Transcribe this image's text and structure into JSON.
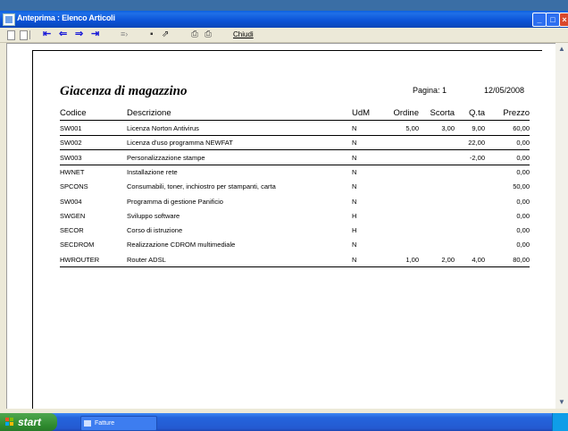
{
  "window": {
    "title": "Anteprima : Elenco Articoli"
  },
  "toolbar": {
    "first_label": "⇤",
    "prev_label": "⇐",
    "next_label": "⇒",
    "last_label": "⇥",
    "close_label": "Chiudi"
  },
  "report": {
    "title": "Giacenza di magazzino",
    "page_label": "Pagina: 1",
    "date": "12/05/2008",
    "columns": {
      "codice": "Codice",
      "descrizione": "Descrizione",
      "udm": "UdM",
      "ordine": "Ordine",
      "scorta": "Scorta",
      "qta": "Q.ta",
      "prezzo": "Prezzo"
    },
    "rows": [
      {
        "codice": "SW001",
        "descrizione": "Licenza Norton Antivirus",
        "udm": "N",
        "ordine": "5,00",
        "scorta": "3,00",
        "qta": "9,00",
        "prezzo": "60,00"
      },
      {
        "codice": "SW002",
        "descrizione": "Licenza d'uso programma NEWFAT",
        "udm": "N",
        "ordine": "",
        "scorta": "",
        "qta": "22,00",
        "prezzo": "0,00"
      },
      {
        "codice": "SW003",
        "descrizione": "Personalizzazione stampe",
        "udm": "N",
        "ordine": "",
        "scorta": "",
        "qta": "-2,00",
        "prezzo": "0,00"
      },
      {
        "codice": "HWNET",
        "descrizione": "Installazione rete",
        "udm": "N",
        "ordine": "",
        "scorta": "",
        "qta": "",
        "prezzo": "0,00"
      },
      {
        "codice": "SPCONS",
        "descrizione": "Consumabili, toner, inchiostro per stampanti, carta",
        "udm": "N",
        "ordine": "",
        "scorta": "",
        "qta": "",
        "prezzo": "50,00"
      },
      {
        "codice": "SW004",
        "descrizione": "Programma di gestione Panificio",
        "udm": "N",
        "ordine": "",
        "scorta": "",
        "qta": "",
        "prezzo": "0,00"
      },
      {
        "codice": "SWGEN",
        "descrizione": "Sviluppo software",
        "udm": "H",
        "ordine": "",
        "scorta": "",
        "qta": "",
        "prezzo": "0,00"
      },
      {
        "codice": "SECOR",
        "descrizione": "Corso di istruzione",
        "udm": "H",
        "ordine": "",
        "scorta": "",
        "qta": "",
        "prezzo": "0,00"
      },
      {
        "codice": "SECDROM",
        "descrizione": "Realizzazione CDROM multimediale",
        "udm": "N",
        "ordine": "",
        "scorta": "",
        "qta": "",
        "prezzo": "0,00"
      },
      {
        "codice": "HWROUTER",
        "descrizione": "Router ADSL",
        "udm": "N",
        "ordine": "1,00",
        "scorta": "2,00",
        "qta": "4,00",
        "prezzo": "80,00"
      }
    ]
  },
  "taskbar": {
    "start_label": "start",
    "task_label": "Fatture"
  },
  "icons": {
    "window": "app-window-icon",
    "save": "save-disk-icon",
    "export": "export-icon",
    "print": "printer-icon",
    "print_setup": "printer-setup-icon"
  }
}
